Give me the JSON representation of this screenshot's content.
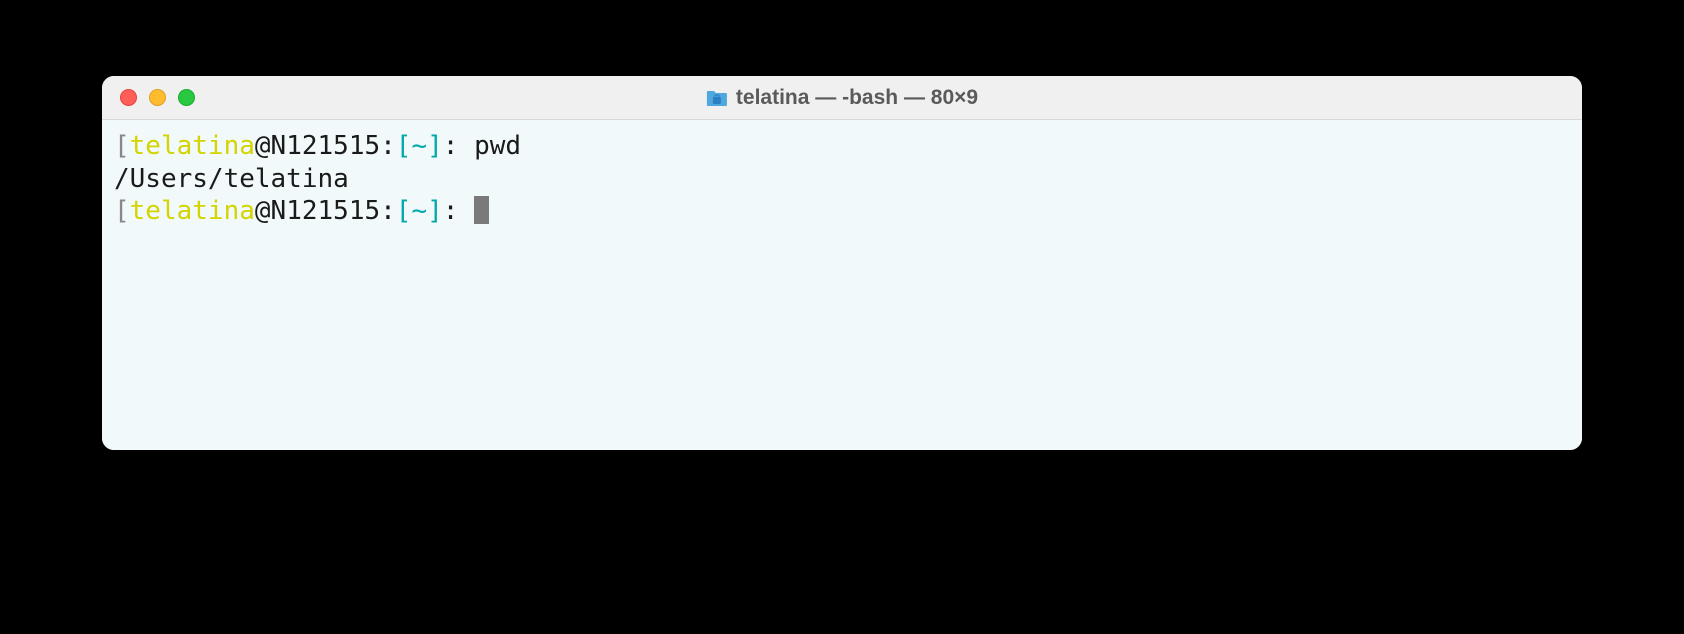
{
  "window": {
    "title": "telatina — -bash — 80×9"
  },
  "prompt1": {
    "open_bracket": "[",
    "user": "telatina",
    "at": "@",
    "host": "N121515",
    "colon1": ":",
    "path_open": "[",
    "path": "~",
    "path_close": "]",
    "colon2": ": ",
    "command": "pwd"
  },
  "output1": {
    "text": "/Users/telatina"
  },
  "prompt2": {
    "open_bracket": "[",
    "user": "telatina",
    "at": "@",
    "host": "N121515",
    "colon1": ":",
    "path_open": "[",
    "path": "~",
    "path_close": "]",
    "colon2": ": "
  }
}
